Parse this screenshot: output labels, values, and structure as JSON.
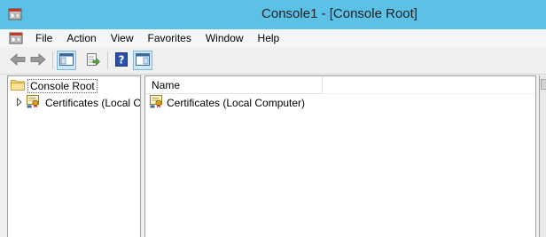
{
  "window": {
    "title": "Console1 - [Console Root]",
    "titlebar_color": "#5bc1e6",
    "app_icon": "mmc-console-icon"
  },
  "menubar": {
    "doc_icon": "mmc-console-icon",
    "items": [
      "File",
      "Action",
      "View",
      "Favorites",
      "Window",
      "Help"
    ]
  },
  "toolbar": {
    "buttons": [
      {
        "icon": "back-arrow-icon",
        "pressed": false
      },
      {
        "icon": "forward-arrow-icon",
        "pressed": false
      },
      {
        "icon": "show-hide-console-tree-icon",
        "pressed": true
      },
      {
        "icon": "export-list-icon",
        "pressed": false
      },
      {
        "icon": "help-icon",
        "pressed": false
      },
      {
        "icon": "show-hide-action-pane-icon",
        "pressed": true
      }
    ]
  },
  "tree": {
    "root_label": "Console Root",
    "root_icon": "folder-icon",
    "children": [
      {
        "label": "Certificates (Local C",
        "icon": "certificate-icon",
        "expander": "expand-arrow-icon"
      }
    ]
  },
  "list": {
    "columns": [
      "Name"
    ],
    "rows": [
      {
        "name": "Certificates (Local Computer)",
        "icon": "certificate-icon"
      }
    ]
  }
}
